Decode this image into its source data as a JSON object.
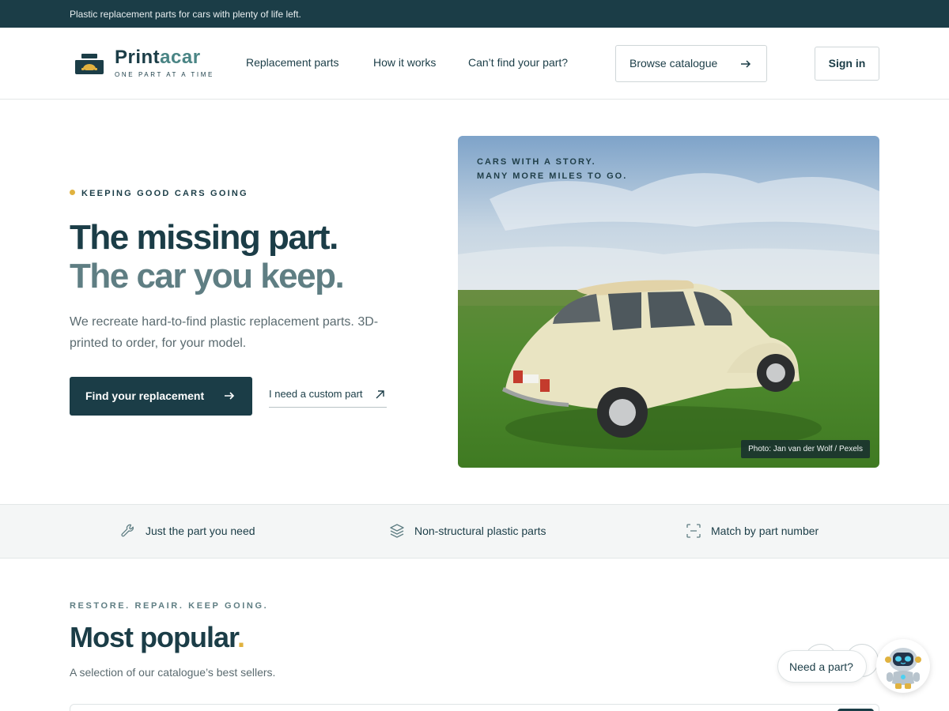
{
  "announcement": {
    "text": "Plastic replacement parts for cars with plenty of life left."
  },
  "brand": {
    "name_part1": "Print",
    "name_part2": "acar",
    "tagline": "ONE PART AT A TIME"
  },
  "nav": {
    "items": [
      "Replacement parts",
      "How it works",
      "Can’t find your part?"
    ],
    "browse_label": "Browse catalogue",
    "signin_label": "Sign in"
  },
  "hero": {
    "eyebrow": "KEEPING GOOD CARS GOING",
    "headline_line1": "The missing part.",
    "headline_line2": "The car you keep.",
    "lead": "We recreate hard-to-find plastic replacement parts. 3D-printed to order, for your model.",
    "primary_cta": "Find your replacement",
    "secondary_cta": "I need a custom part",
    "image_caption_line1": "CARS WITH A STORY.",
    "image_caption_line2": "MANY MORE MILES TO GO.",
    "photo_credit": "Photo: Jan van der Wolf / Pexels"
  },
  "features": [
    {
      "icon": "wrench-icon",
      "label": "Just the part you need"
    },
    {
      "icon": "layers-icon",
      "label": "Non-structural plastic parts"
    },
    {
      "icon": "scan-icon",
      "label": "Match by part number"
    }
  ],
  "popular": {
    "eyebrow": "RESTORE. REPAIR. KEEP GOING.",
    "title": "Most popular",
    "title_dot": ".",
    "subtitle": "A selection of our catalogue’s best sellers."
  },
  "chat": {
    "label": "Need a part?",
    "icon": "robot-icon"
  },
  "colors": {
    "primary": "#1b3d47",
    "accent": "#e0b23f",
    "muted": "#5f7e83"
  }
}
